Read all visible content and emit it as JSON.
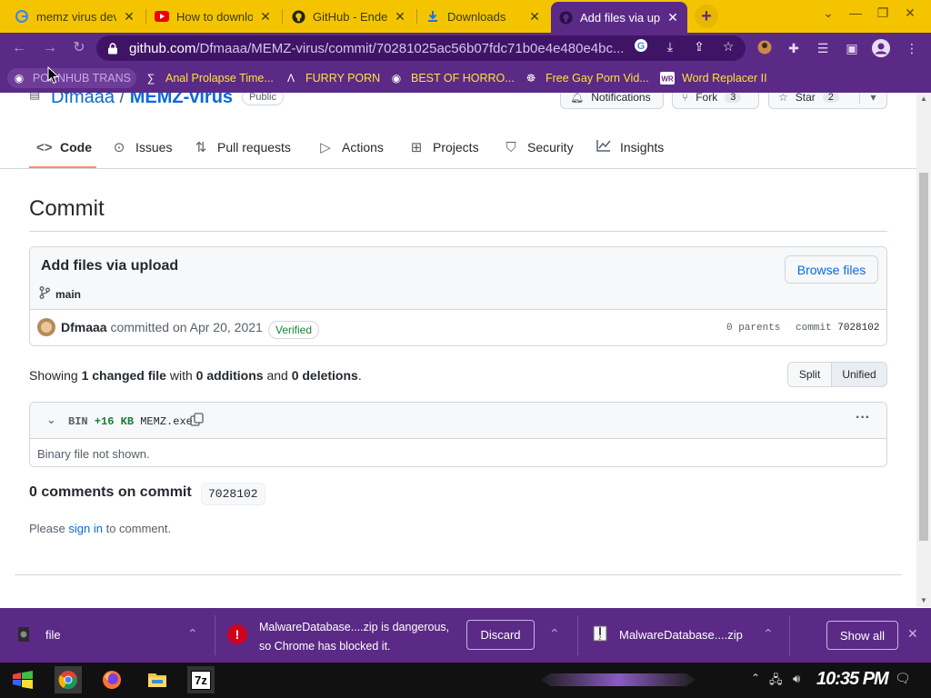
{
  "tabs": [
    {
      "title": "memz virus dev",
      "icon": "google-icon"
    },
    {
      "title": "How to downlo",
      "icon": "youtube-icon"
    },
    {
      "title": "GitHub - Ende",
      "icon": "github-icon"
    },
    {
      "title": "Downloads",
      "icon": "download-icon"
    },
    {
      "title": "Add files via up",
      "icon": "github-icon",
      "active": true
    }
  ],
  "address": {
    "domain": "github.com",
    "path": "/Dfmaaa/MEMZ-virus/commit/70281025ac56b07fdc71b0e4e480e4bc..."
  },
  "bookmarks": [
    "PORNHUB TRANS",
    "Anal Prolapse Time...",
    "FURRY PORN",
    "BEST OF HORRO...",
    "Free Gay Porn Vid...",
    "Word Replacer II"
  ],
  "repo": {
    "owner": "Dfmaaa",
    "sep": "/",
    "name": "MEMZ-virus",
    "visibility": "Public"
  },
  "repo_actions": {
    "notifications": "Notifications",
    "fork": "Fork",
    "fork_count": "3",
    "star": "Star",
    "star_count": "2"
  },
  "repo_nav": [
    "Code",
    "Issues",
    "Pull requests",
    "Actions",
    "Projects",
    "Security",
    "Insights"
  ],
  "commit": {
    "heading": "Commit",
    "title": "Add files via upload",
    "browse": "Browse files",
    "branch": "main",
    "author": "Dfmaaa",
    "committed_on": "committed on Apr 20, 2021",
    "verified": "Verified",
    "parents": "0 parents",
    "commit_label": "commit",
    "sha": "7028102"
  },
  "summary": {
    "showing": "Showing",
    "changed": "1 changed file",
    "with": "with",
    "additions": "0 additions",
    "and": "and",
    "deletions": "0 deletions",
    "period": ".",
    "split": "Split",
    "unified": "Unified"
  },
  "file": {
    "bin": "BIN",
    "size": "+16 KB",
    "name": "MEMZ.exe",
    "more": "···",
    "body": "Binary file not shown."
  },
  "comments": {
    "heading": "0 comments on commit",
    "sha": "7028102",
    "please": "Please",
    "signin": "sign in",
    "tocomment": "to comment."
  },
  "downloads": {
    "item1": "file",
    "warning_line1": "MalwareDatabase....zip is dangerous,",
    "warning_line2": "so Chrome has blocked it.",
    "discard": "Discard",
    "item3": "MalwareDatabase....zip",
    "showall": "Show all"
  },
  "taskbar": {
    "clock": "10:35 PM",
    "app7z": "7z"
  },
  "colors": {
    "chrome_purple": "#5b2a86",
    "tab_yellow": "#f4c400",
    "bookmark_yellow": "#ffe23a",
    "link_blue": "#0969da",
    "danger_red": "#d0021b"
  }
}
